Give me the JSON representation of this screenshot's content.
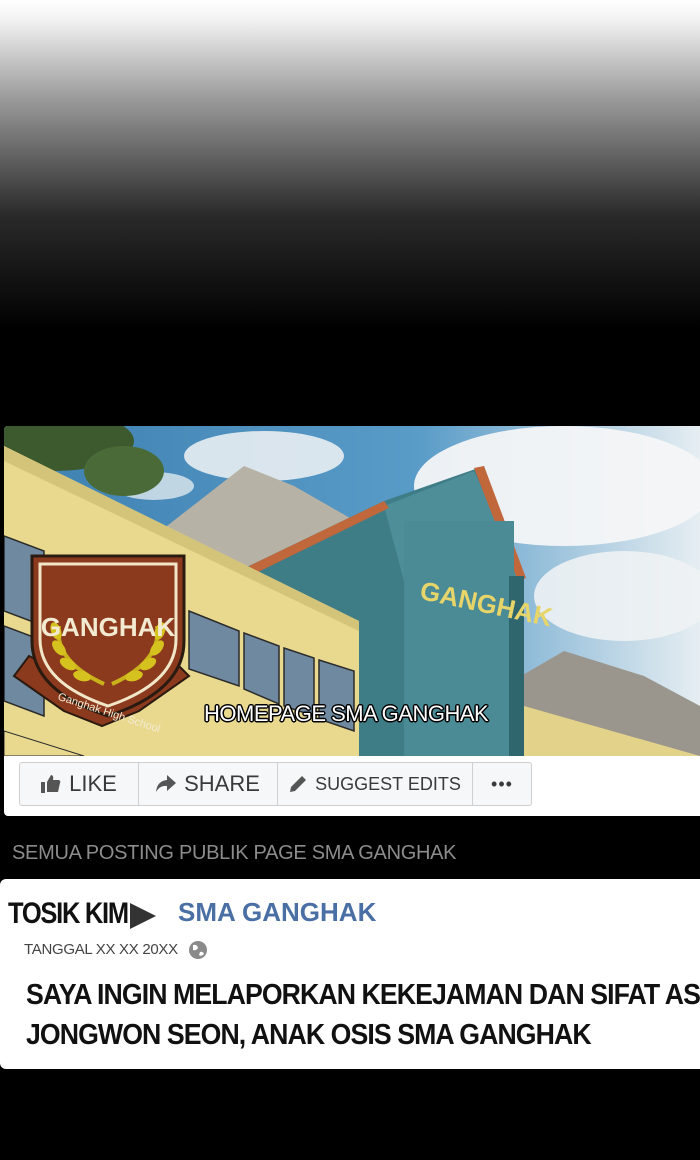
{
  "page": {
    "name": "HOMEPAGE SMA GANGHAK",
    "logo_text": "GANGHAK",
    "logo_subtext": "Ganghak High School",
    "building_sign": "GANGHAK"
  },
  "actions": [
    {
      "label": "LIKE",
      "icon": "thumbs-up-icon"
    },
    {
      "label": "SHARE",
      "icon": "share-arrow-icon"
    },
    {
      "label": "SUGGEST EDITS",
      "icon": "pencil-icon"
    },
    {
      "label": "•••",
      "icon": "more-icon"
    }
  ],
  "section_label": "SEMUA POSTING PUBLIK PAGE SMA GANGHAK",
  "post": {
    "author": "TOSIK KIM",
    "target": "SMA GANGHAK",
    "date": "TANGGAL XX XX 20XX",
    "text_lines": [
      "SAYA INGIN MELAPORKAN KEKEJAMAN DAN SIFAT ASLI",
      "JONGWON SEON, ANAK OSIS SMA GANGHAK"
    ]
  },
  "colors": {
    "link_blue": "#4a6fa5",
    "crest_brown": "#8b3a1e",
    "laurel_gold": "#c9b21a"
  }
}
